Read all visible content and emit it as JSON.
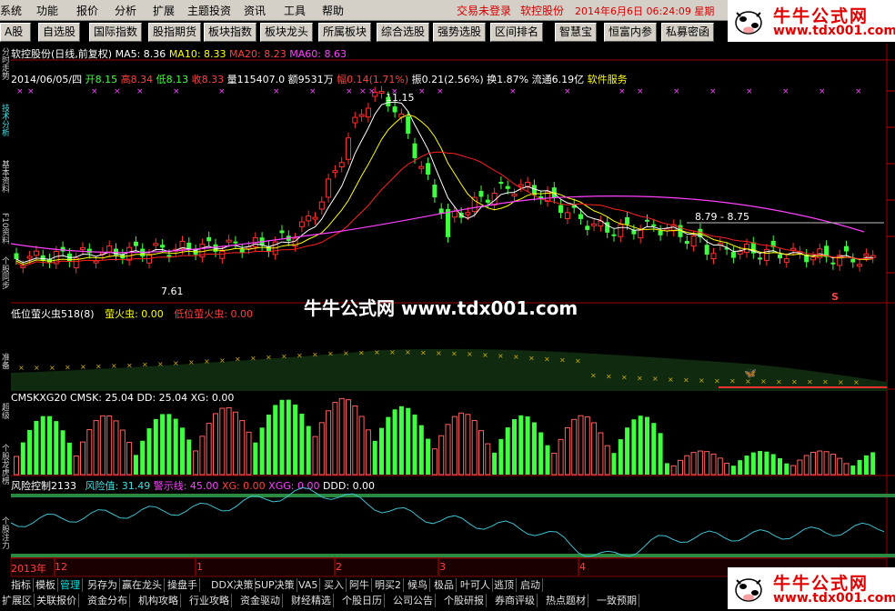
{
  "menu": {
    "items": [
      "系统",
      "功能",
      "报价",
      "分析",
      "扩展",
      "主题投资",
      "资讯",
      "工具",
      "帮助"
    ],
    "status": "交易未登录",
    "stock": "软控股份",
    "datetime": "2014年6月6日 06:24:09 星期"
  },
  "toolbar": {
    "buttons": [
      "A股",
      "自选股",
      "国际指数",
      "股指期货",
      "板块指数",
      "板块龙头",
      "所属板块",
      "综合选股",
      "强势选股",
      "区间排名",
      "智慧宝",
      "恒富内参",
      "私募密函"
    ]
  },
  "left_tabs": [
    "分时走势",
    "技术分析",
    "基本资料",
    "F10资料",
    "个股同步",
    "准备",
    "超级",
    "个股龙虎榜",
    "个股注力"
  ],
  "price_panel": {
    "title": "软控股份(日线,前复权)",
    "ma5": "MA5: 8.36",
    "ma10": "MA10: 8.33",
    "ma20": "MA20: 8.23",
    "ma60": "MA60: 8.63",
    "date": "2014/06/05/四",
    "open": "开8.15",
    "high": "高8.34",
    "low": "低8.13",
    "close": "收8.33",
    "volume": "量115407.0",
    "amount": "额9531万",
    "change": "幅0.14(1.71%)",
    "amplitude": "振0.21(2.56%)",
    "turnover": "换1.87%",
    "float": "流通6.19亿",
    "sector": "软件服务",
    "max_label": "11.15",
    "min_label": "7.61",
    "range_label": "8.79 - 8.75",
    "signal": "S"
  },
  "firefly_panel": {
    "title": "低位萤火虫518(8)",
    "v1": "萤火虫: 0.00",
    "v2": "低位萤火虫: 0.00"
  },
  "cmsk_panel": {
    "title": "CMSKXG20",
    "cmsk": "CMSK: 25.04",
    "dd": "DD: 25.04",
    "xg": "XG: 0.00"
  },
  "risk_panel": {
    "title": "风险控制2133",
    "risk": "风险值: 31.49",
    "warn": "警示线: 45.00",
    "xg": "XG: 0.00",
    "xgg": "XGG: 0.00",
    "ddd": "DDD: 0.00"
  },
  "timeline": {
    "labels": [
      "2013年",
      "12",
      "1",
      "2",
      "3",
      "4"
    ]
  },
  "bottom_tabs1": [
    "指标",
    "模板",
    "管理",
    "另存为",
    "赢在龙头",
    "操盘手",
    "DDX决策",
    "SUP决策",
    "VA5",
    "买入",
    "阿牛",
    "明买2",
    "候鸟",
    "极品",
    "叶可人",
    "逃顶",
    "启动"
  ],
  "bottom_tabs2": [
    "扩展区",
    "关联报价",
    "资金分布",
    "机构攻略",
    "行业攻略",
    "资金驱动",
    "财经精选",
    "个股日历",
    "公司公告",
    "个股研报",
    "券商评级",
    "热点题材",
    "一致预期"
  ],
  "watermark": "牛牛公式网 www.tdx001.com",
  "logo": {
    "title": "牛牛公式网",
    "url": "www.tdx001.com"
  },
  "colors": {
    "up": "#ff3030",
    "down": "#40ff40",
    "ma5": "#ffffff",
    "ma10": "#ffff00",
    "ma20": "#ff2020",
    "ma60": "#ff40ff"
  }
}
